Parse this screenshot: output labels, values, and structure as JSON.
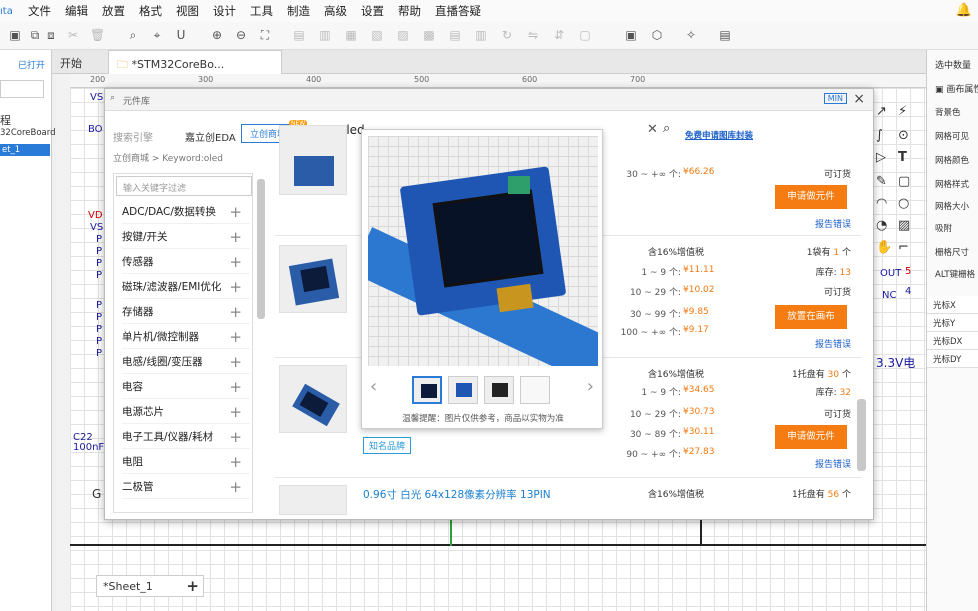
{
  "menu": {
    "logo": "ıta",
    "items": [
      "文件",
      "编辑",
      "放置",
      "格式",
      "视图",
      "设计",
      "工具",
      "制造",
      "高级",
      "设置",
      "帮助",
      "直播答疑"
    ]
  },
  "left_panel": {
    "tab": "已打开",
    "items": [
      "程",
      "32CoreBoard",
      "et_1"
    ]
  },
  "tabs": {
    "start": "开始",
    "doc": "*STM32CoreBo..."
  },
  "ruler": [
    "200",
    "300",
    "400",
    "500",
    "600",
    "700"
  ],
  "schematic": {
    "labels": [
      "VS",
      "BO",
      "VD",
      "VS",
      "P",
      "P",
      "P",
      "P",
      "P",
      "P",
      "P",
      "P",
      "P",
      "C22",
      "100nF",
      "G"
    ],
    "right_labels": [
      "OUT",
      "NC",
      "5",
      "4",
      "3.3V电"
    ]
  },
  "sheet": {
    "name": "*Sheet_1",
    "plus": "+"
  },
  "right_panel": {
    "header": "选中数量",
    "section": "画布属性",
    "props": [
      "背景色",
      "网格可见",
      "网格颜色",
      "网格样式",
      "网格大小",
      "吸附",
      "栅格尺寸",
      "ALT键栅格"
    ],
    "rows": [
      "光标X",
      "光标Y",
      "光标DX",
      "光标DY"
    ]
  },
  "dialog": {
    "title": "元件库",
    "min_label": "MIN",
    "close": "×",
    "source_tabs": [
      "搜索引擎",
      "嘉立创EDA",
      "立创商城"
    ],
    "new_badge": "NEW",
    "search_value": "oled",
    "free_apply": "免费申请图库封装",
    "breadcrumb": "立创商城 > Keyword:oled",
    "filter_placeholder": "输入关键字过滤",
    "categories": [
      "ADC/DAC/数据转换",
      "按键/开关",
      "传感器",
      "磁珠/滤波器/EMI优化",
      "存储器",
      "单片机/微控制器",
      "电感/线圈/变压器",
      "电容",
      "电源芯片",
      "电子工具/仪器/耗材",
      "电阻",
      "二极管"
    ],
    "popup_note": "温馨提醒：图片仅供参考，商品以实物为准",
    "brand_tag": "知名品牌",
    "product_name": "0.96寸 白光 64x128像素分辨率 13PIN",
    "rows": [
      {
        "top_tier": "30 ~ +∞ 个:",
        "top_price": "¥66.26",
        "order": "可订货",
        "button": "申请做元件",
        "report": "报告错误"
      },
      {
        "tax": "含16%增值税",
        "tiers": [
          [
            "1 ~ 9 个:",
            "¥11.11"
          ],
          [
            "10 ~ 29 个:",
            "¥10.02"
          ],
          [
            "30 ~ 99 个:",
            "¥9.85"
          ],
          [
            "100 ~ +∞ 个:",
            "¥9.17"
          ]
        ],
        "pack_label": "1袋有",
        "pack_count": "1",
        "pack_unit": "个",
        "stock_label": "库存:",
        "stock": "13",
        "order": "可订货",
        "button": "放置在画布",
        "report": "报告错误"
      },
      {
        "tax": "含16%增值税",
        "tiers": [
          [
            "1 ~ 9 个:",
            "¥34.65"
          ],
          [
            "10 ~ 29 个:",
            "¥30.73"
          ],
          [
            "30 ~ 89 个:",
            "¥30.11"
          ],
          [
            "90 ~ +∞ 个:",
            "¥27.83"
          ]
        ],
        "pack_label": "1托盘有",
        "pack_count": "30",
        "pack_unit": "个",
        "stock_label": "库存:",
        "stock": "32",
        "order": "可订货",
        "button": "申请做元件",
        "report": "报告错误"
      },
      {
        "tax": "含16%增值税",
        "pack_label": "1托盘有",
        "pack_count": "56",
        "pack_unit": "个"
      }
    ]
  },
  "colors": {
    "accent": "#2a7bd8",
    "order_button": "#f57c12",
    "price": "#f07a10"
  }
}
